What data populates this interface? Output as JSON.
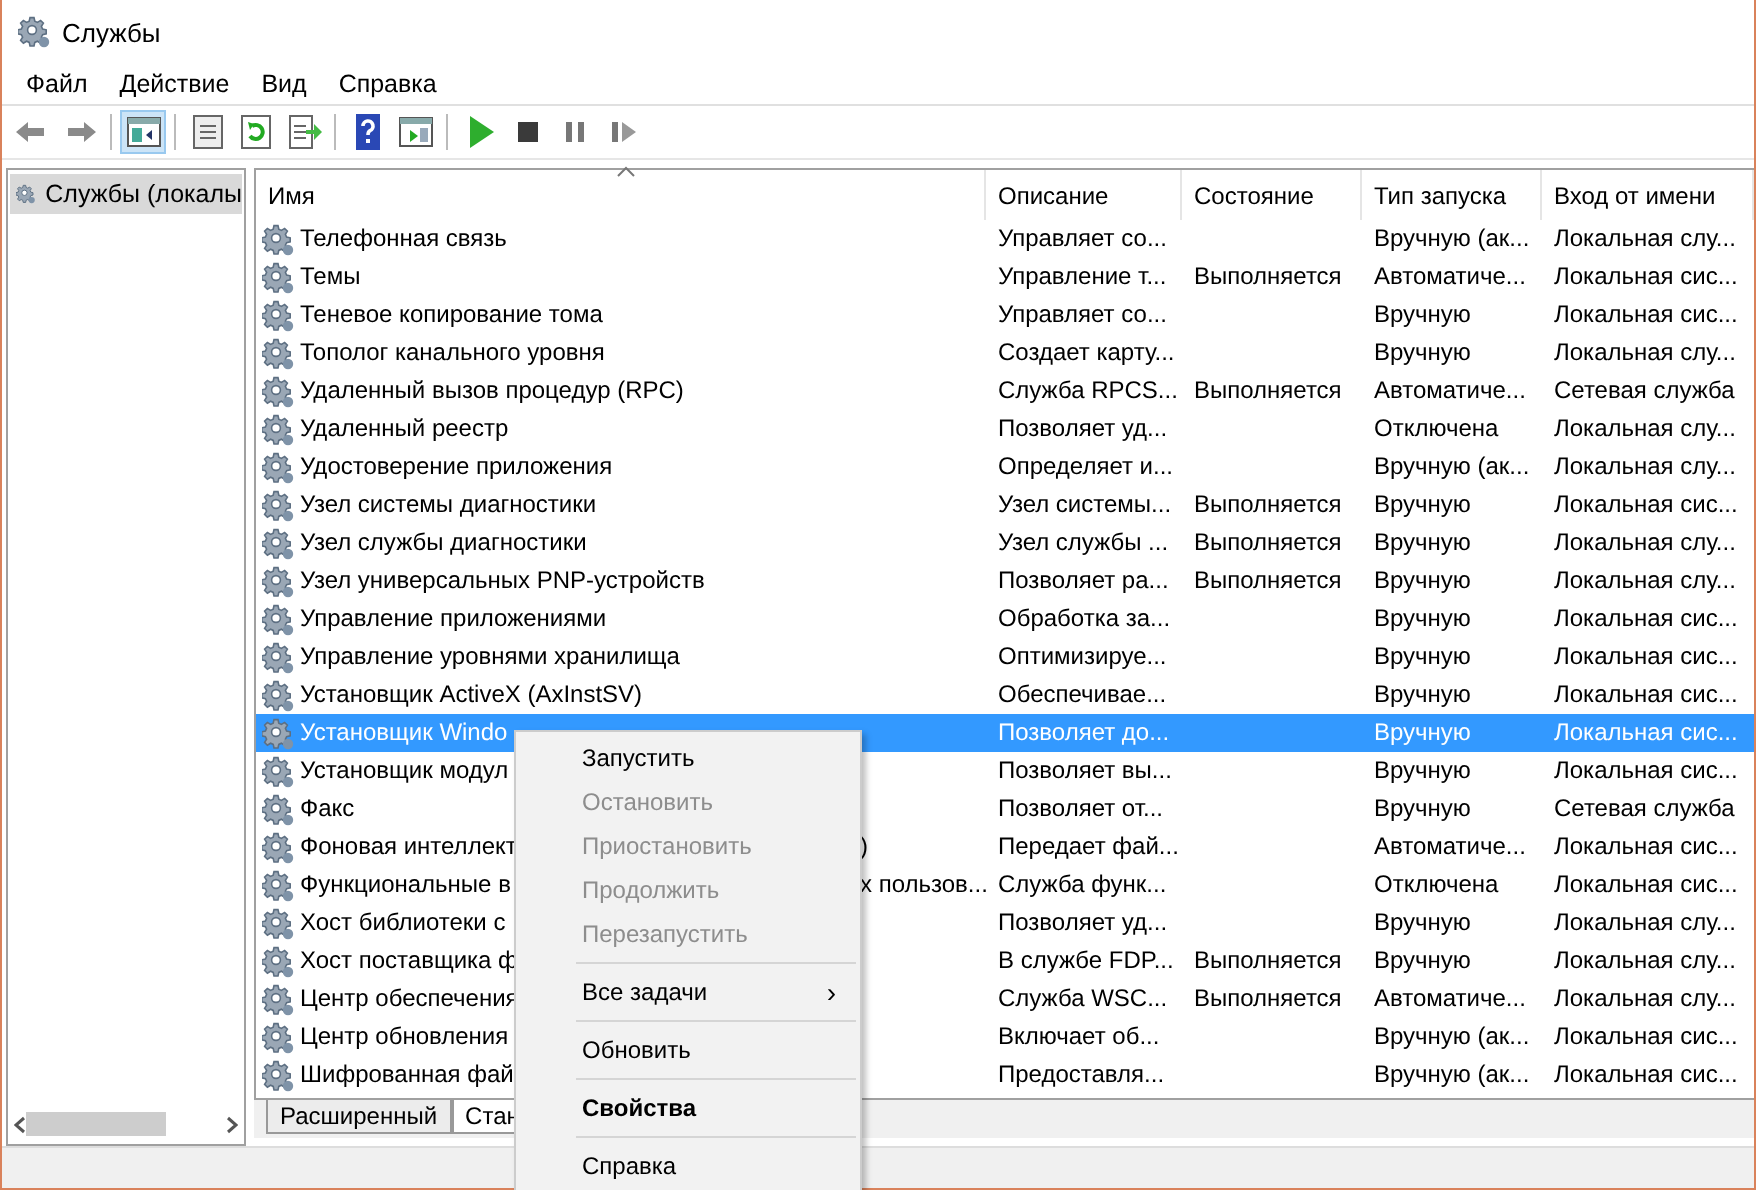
{
  "window": {
    "title": "Службы"
  },
  "menu": [
    "Файл",
    "Действие",
    "Вид",
    "Справка"
  ],
  "toolbar": [
    {
      "kind": "back",
      "selected": false
    },
    {
      "kind": "forward",
      "selected": false
    },
    {
      "kind": "separator"
    },
    {
      "kind": "tree",
      "selected": true
    },
    {
      "kind": "separator"
    },
    {
      "kind": "properties",
      "selected": false
    },
    {
      "kind": "refresh",
      "selected": false
    },
    {
      "kind": "export",
      "selected": false
    },
    {
      "kind": "separator"
    },
    {
      "kind": "help",
      "selected": false
    },
    {
      "kind": "pane",
      "selected": false
    },
    {
      "kind": "separator"
    },
    {
      "kind": "play",
      "selected": false
    },
    {
      "kind": "stop",
      "selected": false
    },
    {
      "kind": "pause",
      "selected": false
    },
    {
      "kind": "resume",
      "selected": false
    }
  ],
  "tree": {
    "label": "Службы (локалы",
    "selected": true
  },
  "table": {
    "columns": [
      {
        "label": "Имя"
      },
      {
        "label": "Описание"
      },
      {
        "label": "Состояние"
      },
      {
        "label": "Тип запуска"
      },
      {
        "label": "Вход от имени"
      }
    ],
    "rows": [
      {
        "name": "Телефонная связь",
        "description": "Управляет со...",
        "status": "",
        "startup": "Вручную (ак...",
        "logon": "Локальная слу...",
        "selected": false
      },
      {
        "name": "Темы",
        "description": "Управление т...",
        "status": "Выполняется",
        "startup": "Автоматиче...",
        "logon": "Локальная сис...",
        "selected": false
      },
      {
        "name": "Теневое копирование тома",
        "description": "Управляет со...",
        "status": "",
        "startup": "Вручную",
        "logon": "Локальная сис...",
        "selected": false
      },
      {
        "name": "Тополог канального уровня",
        "description": "Создает карту...",
        "status": "",
        "startup": "Вручную",
        "logon": "Локальная слу...",
        "selected": false
      },
      {
        "name": "Удаленный вызов процедур (RPC)",
        "description": "Служба RPCS...",
        "status": "Выполняется",
        "startup": "Автоматиче...",
        "logon": "Сетевая служба",
        "selected": false
      },
      {
        "name": "Удаленный реестр",
        "description": "Позволяет уд...",
        "status": "",
        "startup": "Отключена",
        "logon": "Локальная слу...",
        "selected": false
      },
      {
        "name": "Удостоверение приложения",
        "description": "Определяет и...",
        "status": "",
        "startup": "Вручную (ак...",
        "logon": "Локальная слу...",
        "selected": false
      },
      {
        "name": "Узел системы диагностики",
        "description": "Узел системы...",
        "status": "Выполняется",
        "startup": "Вручную",
        "logon": "Локальная сис...",
        "selected": false
      },
      {
        "name": "Узел службы диагностики",
        "description": "Узел службы ...",
        "status": "Выполняется",
        "startup": "Вручную",
        "logon": "Локальная слу...",
        "selected": false
      },
      {
        "name": "Узел универсальных PNP-устройств",
        "description": "Позволяет ра...",
        "status": "Выполняется",
        "startup": "Вручную",
        "logon": "Локальная слу...",
        "selected": false
      },
      {
        "name": "Управление приложениями",
        "description": "Обработка за...",
        "status": "",
        "startup": "Вручную",
        "logon": "Локальная сис...",
        "selected": false
      },
      {
        "name": "Управление уровнями хранилища",
        "description": "Оптимизируе...",
        "status": "",
        "startup": "Вручную",
        "logon": "Локальная сис...",
        "selected": false
      },
      {
        "name": "Установщик ActiveX (AxInstSV)",
        "description": "Обеспечивае...",
        "status": "",
        "startup": "Вручную",
        "logon": "Локальная сис...",
        "selected": false
      },
      {
        "name": "Установщик Windo",
        "description": "Позволяет до...",
        "status": "",
        "startup": "Вручную",
        "logon": "Локальная сис...",
        "selected": true
      },
      {
        "name": "Установщик модул",
        "description": "Позволяет вы...",
        "status": "",
        "startup": "Вручную",
        "logon": "Локальная сис...",
        "selected": false
      },
      {
        "name": "Факс",
        "description": "Позволяет от...",
        "status": "",
        "startup": "Вручную",
        "logon": "Сетевая служба",
        "selected": false
      },
      {
        "name": "Фоновая интеллект",
        "name_tail": ")",
        "description": "Передает фай...",
        "status": "",
        "startup": "Автоматиче...",
        "logon": "Локальная сис...",
        "selected": false
      },
      {
        "name": "Функциональные в",
        "name_tail": "х пользов...",
        "description": "Служба функ...",
        "status": "",
        "startup": "Отключена",
        "logon": "Локальная сис...",
        "selected": false
      },
      {
        "name": "Хост библиотеки с",
        "description": "Позволяет уд...",
        "status": "",
        "startup": "Вручную",
        "logon": "Локальная слу...",
        "selected": false
      },
      {
        "name": "Хост поставщика ф",
        "description": "В службе FDP...",
        "status": "Выполняется",
        "startup": "Вручную",
        "logon": "Локальная слу...",
        "selected": false
      },
      {
        "name": "Центр обеспечения",
        "description": "Служба WSC...",
        "status": "Выполняется",
        "startup": "Автоматиче...",
        "logon": "Локальная слу...",
        "selected": false
      },
      {
        "name": "Центр обновления",
        "description": "Включает об...",
        "status": "",
        "startup": "Вручную (ак...",
        "logon": "Локальная сис...",
        "selected": false
      },
      {
        "name": "Шифрованная фай",
        "description": "Предоставля...",
        "status": "",
        "startup": "Вручную (ак...",
        "logon": "Локальная сис...",
        "selected": false
      }
    ]
  },
  "view_tabs": [
    {
      "label": "Расширенный",
      "selected": false
    },
    {
      "label": "Стан",
      "selected": true
    }
  ],
  "context_menu": [
    {
      "kind": "item",
      "label": "Запустить",
      "disabled": false
    },
    {
      "kind": "item",
      "label": "Остановить",
      "disabled": true
    },
    {
      "kind": "item",
      "label": "Приостановить",
      "disabled": true
    },
    {
      "kind": "item",
      "label": "Продолжить",
      "disabled": true
    },
    {
      "kind": "item",
      "label": "Перезапустить",
      "disabled": true
    },
    {
      "kind": "separator"
    },
    {
      "kind": "submenu",
      "label": "Все задачи",
      "arrow": "›",
      "disabled": false
    },
    {
      "kind": "separator"
    },
    {
      "kind": "item",
      "label": "Обновить",
      "disabled": false
    },
    {
      "kind": "separator"
    },
    {
      "kind": "default",
      "label": "Свойства",
      "disabled": false
    },
    {
      "kind": "separator"
    },
    {
      "kind": "item",
      "label": "Справка",
      "disabled": false
    }
  ]
}
